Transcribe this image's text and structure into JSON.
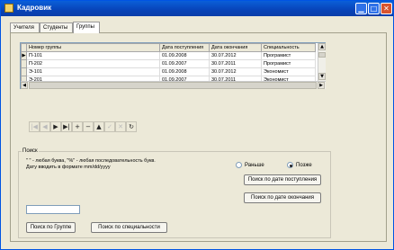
{
  "window": {
    "title": "Кадровик",
    "controls": {
      "minimize": "▁",
      "maximize": "□",
      "close": "✕"
    }
  },
  "tabs": [
    {
      "label": "Учителя",
      "active": false
    },
    {
      "label": "Студенты",
      "active": false
    },
    {
      "label": "Группы",
      "active": true
    }
  ],
  "grid": {
    "columns": [
      "Номер группы",
      "Дата поступления",
      "Дата окончания",
      "Специальность"
    ],
    "current_row_indicator": "▶",
    "rows": [
      [
        "П-101",
        "01.09.2008",
        "30.07.2012",
        "Програмист"
      ],
      [
        "П-202",
        "01.09.2007",
        "30.07.2011",
        "Програмист"
      ],
      [
        "Э-101",
        "01.09.2008",
        "30.07.2012",
        "Экономист"
      ],
      [
        "Э-201",
        "01.09.2007",
        "30.07.2011",
        "Экономист"
      ]
    ]
  },
  "navigator": {
    "first": "|◀",
    "prior": "◀",
    "next": "▶",
    "last": "▶|",
    "insert": "+",
    "delete": "−",
    "edit": "▲",
    "post": "✓",
    "cancel": "✕",
    "refresh": "↻"
  },
  "search": {
    "group_title": "Поиск",
    "hint1": "\" \" - любая буква, \"%\" - любая последовательность букв.",
    "hint2": "Дату вводить в формате mm/dd/yyyy",
    "input_value": "",
    "btn_group": "Поиск по Группе",
    "btn_specialty": "Поиск по специальности",
    "radio_earlier": "Раньше",
    "radio_later": "Позже",
    "radio_selected": "later",
    "btn_by_start": "Поиск по дате поступления",
    "btn_by_end": "Поиск по дате окончания"
  },
  "colors": {
    "titlebar": "#0a5fd8",
    "window_bg": "#ece9d8",
    "close_button": "#d8542f"
  }
}
